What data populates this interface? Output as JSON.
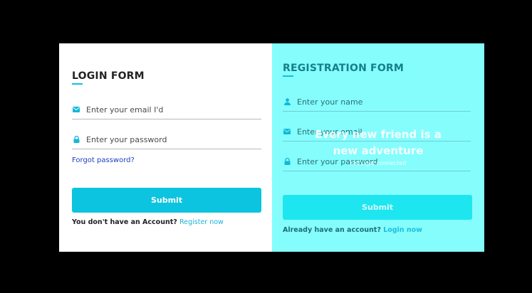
{
  "login": {
    "title": "LOGIN FORM",
    "email_placeholder": "Enter your email I'd",
    "password_placeholder": "Enter your password",
    "forgot_label": "Forgot password?",
    "submit_label": "Submit",
    "account_prompt": "You don't have an Account?",
    "register_link": "Register now"
  },
  "register": {
    "title": "REGISTRATION FORM",
    "name_placeholder": "Enter your name",
    "email_placeholder": "Enter your email",
    "password_placeholder": "Enter your password",
    "submit_label": "Submit",
    "account_prompt": "Already have an account?",
    "login_link": "Login now"
  },
  "overlay": {
    "heading": "Every new friend is a new adventure",
    "subheading": "Let's get connected"
  },
  "colors": {
    "accent": "#0cc4df",
    "register_panel": "#85fdfd",
    "login_panel": "#ffffff",
    "background": "#000000"
  },
  "icons": {
    "email": "envelope-icon",
    "password": "lock-icon",
    "name": "user-icon"
  }
}
